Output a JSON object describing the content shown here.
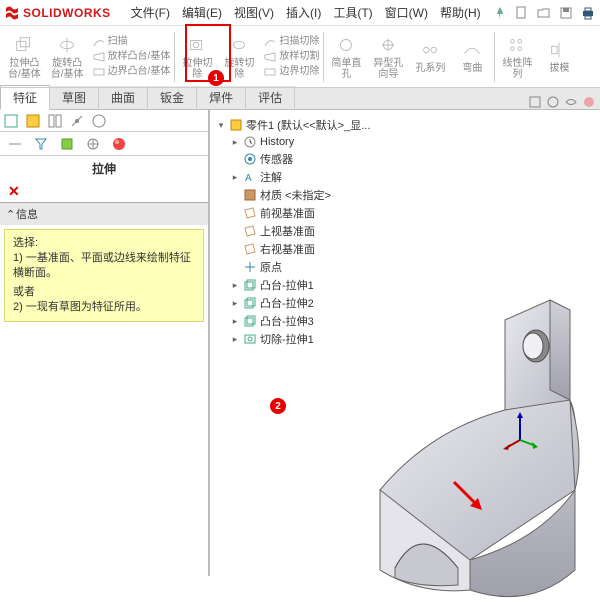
{
  "app": {
    "brand": "SOLIDWORKS"
  },
  "menu": {
    "file": "文件(F)",
    "edit": "编辑(E)",
    "view": "视图(V)",
    "insert": "插入(I)",
    "tools": "工具(T)",
    "window": "窗口(W)",
    "help": "帮助(H)"
  },
  "ribbon": {
    "extrude_boss": "拉伸凸\n台/基体",
    "revolve_boss": "旋转凸\n台/基体",
    "sweep_boss": "扫描",
    "loft_boss": "放样凸台/基体",
    "boundary_boss": "边界凸台/基体",
    "extrude_cut": "拉伸切\n除",
    "revolve_cut": "旋转切\n除",
    "sweep_cut": "扫描切除",
    "loft_cut": "放样切割",
    "boundary_cut": "边界切除",
    "hole_wizard": "异型孔\n向导",
    "fillet": "简单直\n孔",
    "hole_series": "孔系列",
    "bent": "弯曲",
    "linear_pattern": "线性阵\n列",
    "mirror": "拔模"
  },
  "tabs": {
    "feature": "特征",
    "sketch": "草图",
    "surface": "曲面",
    "sheetmetal": "钣金",
    "weldment": "焊件",
    "evaluate": "评估"
  },
  "panel": {
    "title": "拉伸",
    "section_info": "信息",
    "msg_select": "选择:",
    "msg_l1": "1) 一基准面、平面或边线来绘制特征横断面。",
    "msg_or": "或者",
    "msg_l2": "2) 一现有草图为特征所用。"
  },
  "tree": {
    "root": "零件1 (默认<<默认>_显...",
    "history": "History",
    "sensors": "传感器",
    "annotations": "注解",
    "material": "材质 <未指定>",
    "plane_front": "前视基准面",
    "plane_top": "上视基准面",
    "plane_right": "右视基准面",
    "origin": "原点",
    "boss1": "凸台-拉伸1",
    "boss2": "凸台-拉伸2",
    "boss3": "凸台-拉伸3",
    "cut1": "切除-拉伸1"
  },
  "callouts": {
    "one": "1",
    "two": "2"
  },
  "colors": {
    "red": "#e60000",
    "brand": "#d01818"
  }
}
